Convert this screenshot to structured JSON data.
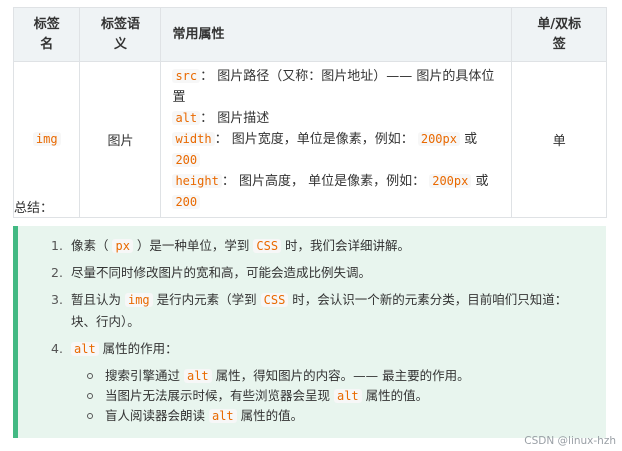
{
  "table": {
    "headers": [
      "标签\n名",
      "标签语\n义",
      "常用属性",
      "单/双标\n签"
    ],
    "row": {
      "tag": "img",
      "meaning": "图片",
      "props": [
        [
          {
            "code": "src"
          },
          {
            "text": "： 图片路径（又称：图片地址）—— 图片的具体位置"
          }
        ],
        [
          {
            "code": "alt"
          },
          {
            "text": "： 图片描述"
          }
        ],
        [
          {
            "code": "width"
          },
          {
            "text": "： 图片宽度，单位是像素，例如： "
          },
          {
            "code": "200px"
          },
          {
            "text": " 或 "
          },
          {
            "code": "200"
          }
        ],
        [
          {
            "code": "height"
          },
          {
            "text": "： 图片高度， 单位是像素，例如： "
          },
          {
            "code": "200px"
          },
          {
            "text": " 或"
          }
        ],
        [
          {
            "code": "200"
          }
        ]
      ],
      "type": "单"
    }
  },
  "summary_label": "总结：",
  "notes": {
    "items": [
      {
        "num": "1.",
        "parts": [
          {
            "text": "像素（ "
          },
          {
            "code": "px"
          },
          {
            "text": " ）是一种单位，学到 "
          },
          {
            "code": "CSS"
          },
          {
            "text": " 时，我们会详细讲解。"
          }
        ]
      },
      {
        "num": "2.",
        "parts": [
          {
            "text": "尽量不同时修改图片的宽和高，可能会造成比例失调。"
          }
        ]
      },
      {
        "num": "3.",
        "parts": [
          {
            "text": "暂且认为 "
          },
          {
            "code": "img"
          },
          {
            "text": " 是行内元素（学到 "
          },
          {
            "code": "CSS"
          },
          {
            "text": " 时，会认识一个新的元素分类，目前咱们只知道："
          }
        ],
        "line2": "块、行内）。"
      },
      {
        "num": "4.",
        "parts": [
          {
            "code": "alt"
          },
          {
            "text": " 属性的作用："
          }
        ]
      }
    ],
    "sub_items": [
      [
        {
          "text": "搜索引擎通过 "
        },
        {
          "code": "alt"
        },
        {
          "text": " 属性，得知图片的内容。—— 最主要的作用。"
        }
      ],
      [
        {
          "text": "当图片无法展示时候，有些浏览器会呈现 "
        },
        {
          "code": "alt"
        },
        {
          "text": " 属性的值。"
        }
      ],
      [
        {
          "text": "盲人阅读器会朗读 "
        },
        {
          "code": "alt"
        },
        {
          "text": " 属性的值。"
        }
      ]
    ]
  },
  "watermark": "CSDN @linux-hzh",
  "colors": {
    "accent": "#42b983",
    "code_text": "#e96900",
    "note_bg": "#e8f5ee",
    "header_bg": "#eff3f5"
  }
}
